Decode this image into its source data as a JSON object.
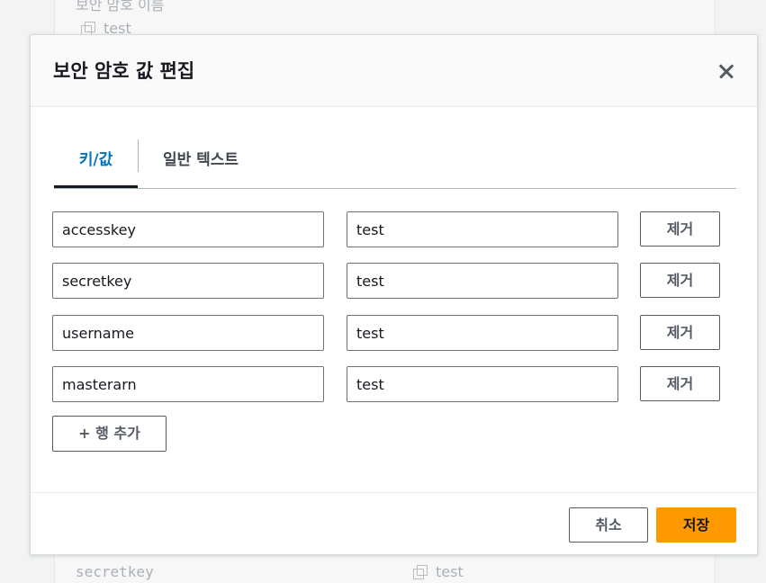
{
  "background": {
    "top_label": "보안 암호 이름",
    "top_value": "test",
    "bottom_key": "secretkey",
    "bottom_value": "test"
  },
  "modal": {
    "title": "보안 암호 값 편집",
    "tabs": [
      {
        "label": "키/값",
        "active": true
      },
      {
        "label": "일반 텍스트",
        "active": false
      }
    ],
    "rows": [
      {
        "key": "accesskey",
        "value": "test",
        "remove_label": "제거"
      },
      {
        "key": "secretkey",
        "value": "test",
        "remove_label": "제거"
      },
      {
        "key": "username",
        "value": "test",
        "remove_label": "제거"
      },
      {
        "key": "masterarn",
        "value": "test",
        "remove_label": "제거"
      }
    ],
    "add_row_label": "+ 행 추가",
    "cancel_label": "취소",
    "save_label": "저장"
  },
  "colors": {
    "accent": "#ff9900",
    "active_tab": "#0073bb"
  }
}
